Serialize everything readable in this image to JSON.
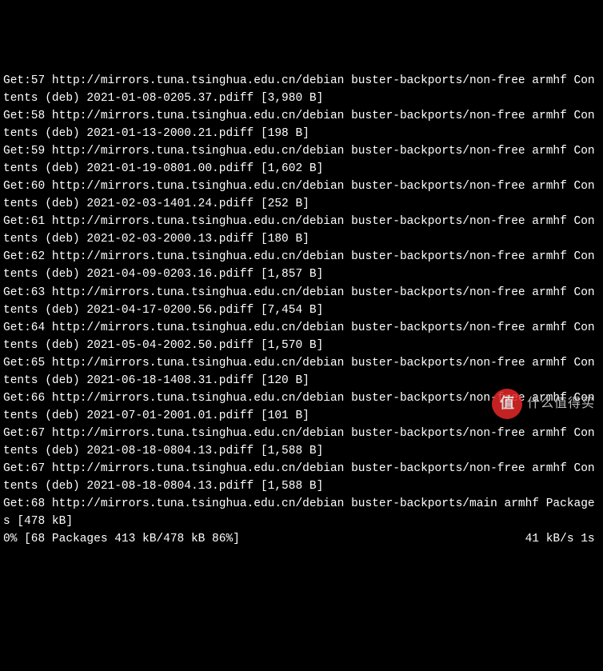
{
  "terminal": {
    "entries": [
      {
        "idx": "57",
        "url": "http://mirrors.tuna.tsinghua.edu.cn/debian",
        "suite": "buster-backports/non-free armhf Contents (deb)",
        "file": "2021-01-08-0205.37.pdiff",
        "size": "3,980 B"
      },
      {
        "idx": "58",
        "url": "http://mirrors.tuna.tsinghua.edu.cn/debian",
        "suite": "buster-backports/non-free armhf Contents (deb)",
        "file": "2021-01-13-2000.21.pdiff",
        "size": "198 B"
      },
      {
        "idx": "59",
        "url": "http://mirrors.tuna.tsinghua.edu.cn/debian",
        "suite": "buster-backports/non-free armhf Contents (deb)",
        "file": "2021-01-19-0801.00.pdiff",
        "size": "1,602 B"
      },
      {
        "idx": "60",
        "url": "http://mirrors.tuna.tsinghua.edu.cn/debian",
        "suite": "buster-backports/non-free armhf Contents (deb)",
        "file": "2021-02-03-1401.24.pdiff",
        "size": "252 B"
      },
      {
        "idx": "61",
        "url": "http://mirrors.tuna.tsinghua.edu.cn/debian",
        "suite": "buster-backports/non-free armhf Contents (deb)",
        "file": "2021-02-03-2000.13.pdiff",
        "size": "180 B"
      },
      {
        "idx": "62",
        "url": "http://mirrors.tuna.tsinghua.edu.cn/debian",
        "suite": "buster-backports/non-free armhf Contents (deb)",
        "file": "2021-04-09-0203.16.pdiff",
        "size": "1,857 B"
      },
      {
        "idx": "63",
        "url": "http://mirrors.tuna.tsinghua.edu.cn/debian",
        "suite": "buster-backports/non-free armhf Contents (deb)",
        "file": "2021-04-17-0200.56.pdiff",
        "size": "7,454 B"
      },
      {
        "idx": "64",
        "url": "http://mirrors.tuna.tsinghua.edu.cn/debian",
        "suite": "buster-backports/non-free armhf Contents (deb)",
        "file": "2021-05-04-2002.50.pdiff",
        "size": "1,570 B"
      },
      {
        "idx": "65",
        "url": "http://mirrors.tuna.tsinghua.edu.cn/debian",
        "suite": "buster-backports/non-free armhf Contents (deb)",
        "file": "2021-06-18-1408.31.pdiff",
        "size": "120 B"
      },
      {
        "idx": "66",
        "url": "http://mirrors.tuna.tsinghua.edu.cn/debian",
        "suite": "buster-backports/non-free armhf Contents (deb)",
        "file": "2021-07-01-2001.01.pdiff",
        "size": "101 B"
      },
      {
        "idx": "67",
        "url": "http://mirrors.tuna.tsinghua.edu.cn/debian",
        "suite": "buster-backports/non-free armhf Contents (deb)",
        "file": "2021-08-18-0804.13.pdiff",
        "size": "1,588 B"
      },
      {
        "idx": "67",
        "url": "http://mirrors.tuna.tsinghua.edu.cn/debian",
        "suite": "buster-backports/non-free armhf Contents (deb)",
        "file": "2021-08-18-0804.13.pdiff",
        "size": "1,588 B"
      }
    ],
    "packages_line": "Get:68 http://mirrors.tuna.tsinghua.edu.cn/debian buster-backports/main armhf Packages [478 kB]",
    "progress_line": "0% [68 Packages 413 kB/478 kB 86%]                                         41 kB/s 1s"
  },
  "watermark": {
    "badge": "值",
    "text": "什么值得买"
  }
}
